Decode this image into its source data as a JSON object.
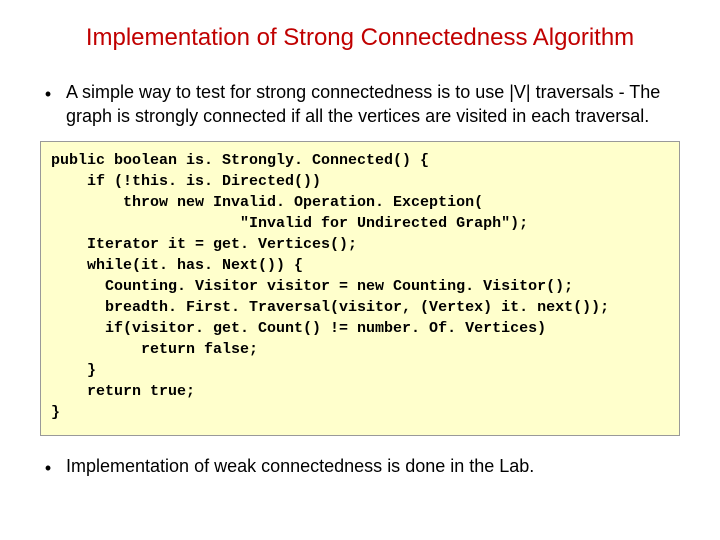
{
  "title": "Implementation of Strong Connectedness Algorithm",
  "bullets": {
    "b1": "A simple way to test for strong connectedness is to use |V| traversals - The graph is strongly connected if all the vertices are visited in each traversal.",
    "b2": "Implementation of weak connectedness is done in the Lab."
  },
  "code": "public boolean is. Strongly. Connected() {\n    if (!this. is. Directed())\n        throw new Invalid. Operation. Exception(\n                     \"Invalid for Undirected Graph\");\n    Iterator it = get. Vertices();\n    while(it. has. Next()) {\n      Counting. Visitor visitor = new Counting. Visitor();\n      breadth. First. Traversal(visitor, (Vertex) it. next());\n      if(visitor. get. Count() != number. Of. Vertices)\n          return false;\n    }\n    return true;\n}"
}
